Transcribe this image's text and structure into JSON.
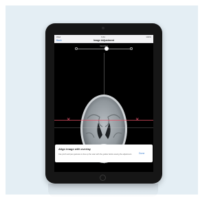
{
  "status_bar": {
    "carrier": "iPad",
    "time": "9:41",
    "battery": "100%"
  },
  "navbar": {
    "back_label": "Back",
    "title": "Image Adjustment"
  },
  "slider": {
    "label": "Contrast",
    "value": 0.55
  },
  "dialog": {
    "title": "Align image with overlay",
    "body": "Use pinch and pan gestures to line up the scan with the guides before saving the adjustment.",
    "button_label": "Done"
  },
  "colors": {
    "accent": "#3b7fd0",
    "guide": "#e2506a",
    "backdrop": "#e4eef4"
  }
}
